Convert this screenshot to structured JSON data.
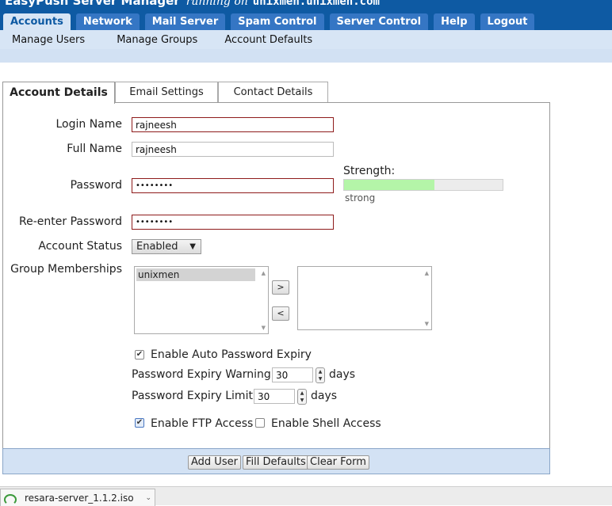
{
  "app": {
    "title": "EasyPush Server Manager",
    "running_on": "running on",
    "host": "unixmen.unixmen.com"
  },
  "main_tabs": [
    {
      "label": "Accounts",
      "active": true
    },
    {
      "label": "Network"
    },
    {
      "label": "Mail Server"
    },
    {
      "label": "Spam Control"
    },
    {
      "label": "Server Control"
    },
    {
      "label": "Help"
    },
    {
      "label": "Logout"
    }
  ],
  "sub_nav": [
    "Manage Users",
    "Manage Groups",
    "Account Defaults"
  ],
  "content_tabs": [
    "Account Details",
    "Email Settings",
    "Contact Details"
  ],
  "form": {
    "login_name": {
      "label": "Login Name",
      "value": "rajneesh"
    },
    "full_name": {
      "label": "Full Name",
      "value": "rajneesh"
    },
    "password": {
      "label": "Password",
      "value": "••••••••"
    },
    "reenter_password": {
      "label": "Re-enter Password",
      "value": "••••••••"
    },
    "strength": {
      "label": "Strength:",
      "value_text": "strong",
      "level": 0.57
    },
    "account_status": {
      "label": "Account Status",
      "selected": "Enabled"
    },
    "group_memberships": {
      "label": "Group Memberships",
      "available": [
        "unixmen"
      ],
      "add_label": ">",
      "remove_label": "<"
    },
    "auto_expiry": {
      "label": "Enable Auto Password Expiry",
      "checked": true
    },
    "expiry_warning": {
      "label": "Password Expiry Warning:",
      "value": "30",
      "unit": "days"
    },
    "expiry_limit": {
      "label": "Password Expiry Limit:",
      "value": "30",
      "unit": "days"
    },
    "ftp_access": {
      "label": "Enable FTP Access",
      "checked": true
    },
    "shell_access": {
      "label": "Enable Shell Access",
      "checked": false
    }
  },
  "actions": {
    "add_user": "Add User",
    "fill_defaults": "Fill Defaults",
    "clear_form": "Clear Form"
  },
  "download": {
    "file": "resara-server_1.1.2.iso"
  },
  "icons": {
    "check": "✔",
    "up": "▲",
    "down": "▼",
    "menu": "⌄"
  },
  "colors": {
    "header_blue": "#0e5aa3",
    "tab_blue": "#3576c4",
    "error_border": "#8e1b1b",
    "strength_fill": "#b4f5a8"
  }
}
